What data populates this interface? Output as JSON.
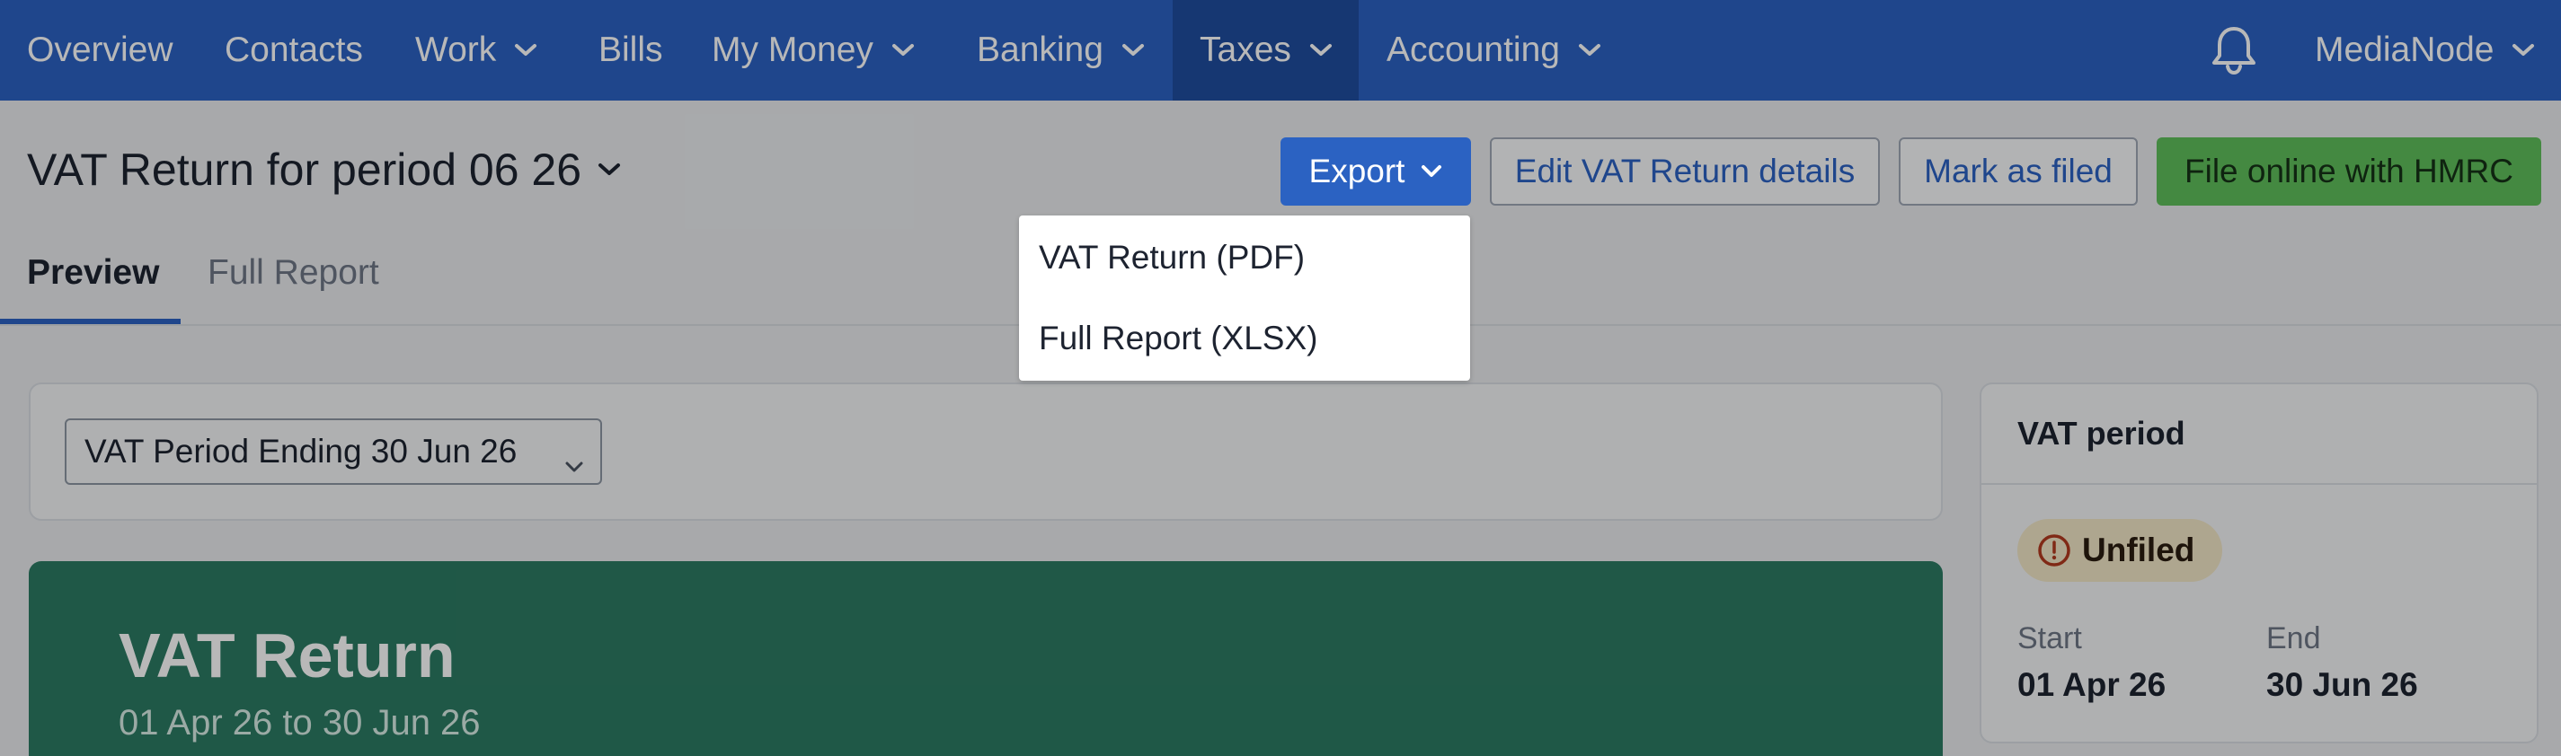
{
  "nav": {
    "items": [
      {
        "label": "Overview",
        "has_dropdown": false
      },
      {
        "label": "Contacts",
        "has_dropdown": false
      },
      {
        "label": "Work",
        "has_dropdown": true
      },
      {
        "label": "Bills",
        "has_dropdown": false
      },
      {
        "label": "My Money",
        "has_dropdown": true
      },
      {
        "label": "Banking",
        "has_dropdown": true
      },
      {
        "label": "Taxes",
        "has_dropdown": true,
        "active": true
      },
      {
        "label": "Accounting",
        "has_dropdown": true
      }
    ],
    "notifications_icon": "bell-icon",
    "account_label": "MediaNode"
  },
  "header": {
    "title": "VAT Return for period 06 26",
    "export_label": "Export",
    "edit_label": "Edit VAT Return details",
    "mark_label": "Mark as filed",
    "file_label": "File online with HMRC"
  },
  "export_menu": {
    "items": [
      "VAT Return (PDF)",
      "Full Report (XLSX)"
    ]
  },
  "tabs": [
    {
      "label": "Preview",
      "active": true
    },
    {
      "label": "Full Report",
      "active": false
    }
  ],
  "period_select": {
    "value": "VAT Period Ending 30 Jun 26"
  },
  "vat_return": {
    "title": "VAT Return",
    "range": "01 Apr 26 to 30 Jun 26"
  },
  "vat_period": {
    "title": "VAT period",
    "status": "Unfiled",
    "start_label": "Start",
    "start_value": "01 Apr 26",
    "end_label": "End",
    "end_value": "30 Jun 26"
  },
  "colors": {
    "nav_bg": "#2b62c2",
    "primary": "#2b62c2",
    "success": "#5fbe5a",
    "vat_card": "#2c7a63",
    "badge_bg": "#f2e6c6"
  }
}
